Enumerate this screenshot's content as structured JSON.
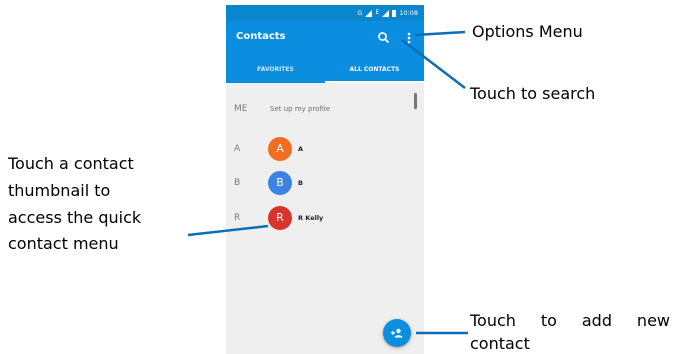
{
  "status_bar": {
    "time": "10:08",
    "network": "G"
  },
  "app": {
    "title": "Contacts",
    "tabs": [
      {
        "label": "FAVORITES",
        "active": false
      },
      {
        "label": "ALL CONTACTS",
        "active": true
      }
    ]
  },
  "profile": {
    "letter": "ME",
    "label": "Set up my profile"
  },
  "contacts": [
    {
      "section": "A",
      "initial": "A",
      "name": "A",
      "avatar_color": "#f26d21"
    },
    {
      "section": "B",
      "initial": "B",
      "name": "B",
      "avatar_color": "#3b82e4"
    },
    {
      "section": "R",
      "initial": "R",
      "name": "R Kelly",
      "avatar_color": "#d9342b"
    }
  ],
  "annotations": {
    "options_menu": "Options Menu",
    "search": "Touch to search",
    "thumbnail": [
      "Touch a contact",
      "thumbnail to",
      "access the quick",
      "contact menu"
    ],
    "add_new": [
      "Touch to add new",
      "contact"
    ]
  },
  "colors": {
    "primary": "#0b8ee0",
    "status_bar": "#0a86cf",
    "callout": "#0b6fb8"
  },
  "icons": {
    "search": "search-icon",
    "options": "more-vert-icon",
    "add_contact": "add-person-icon"
  }
}
